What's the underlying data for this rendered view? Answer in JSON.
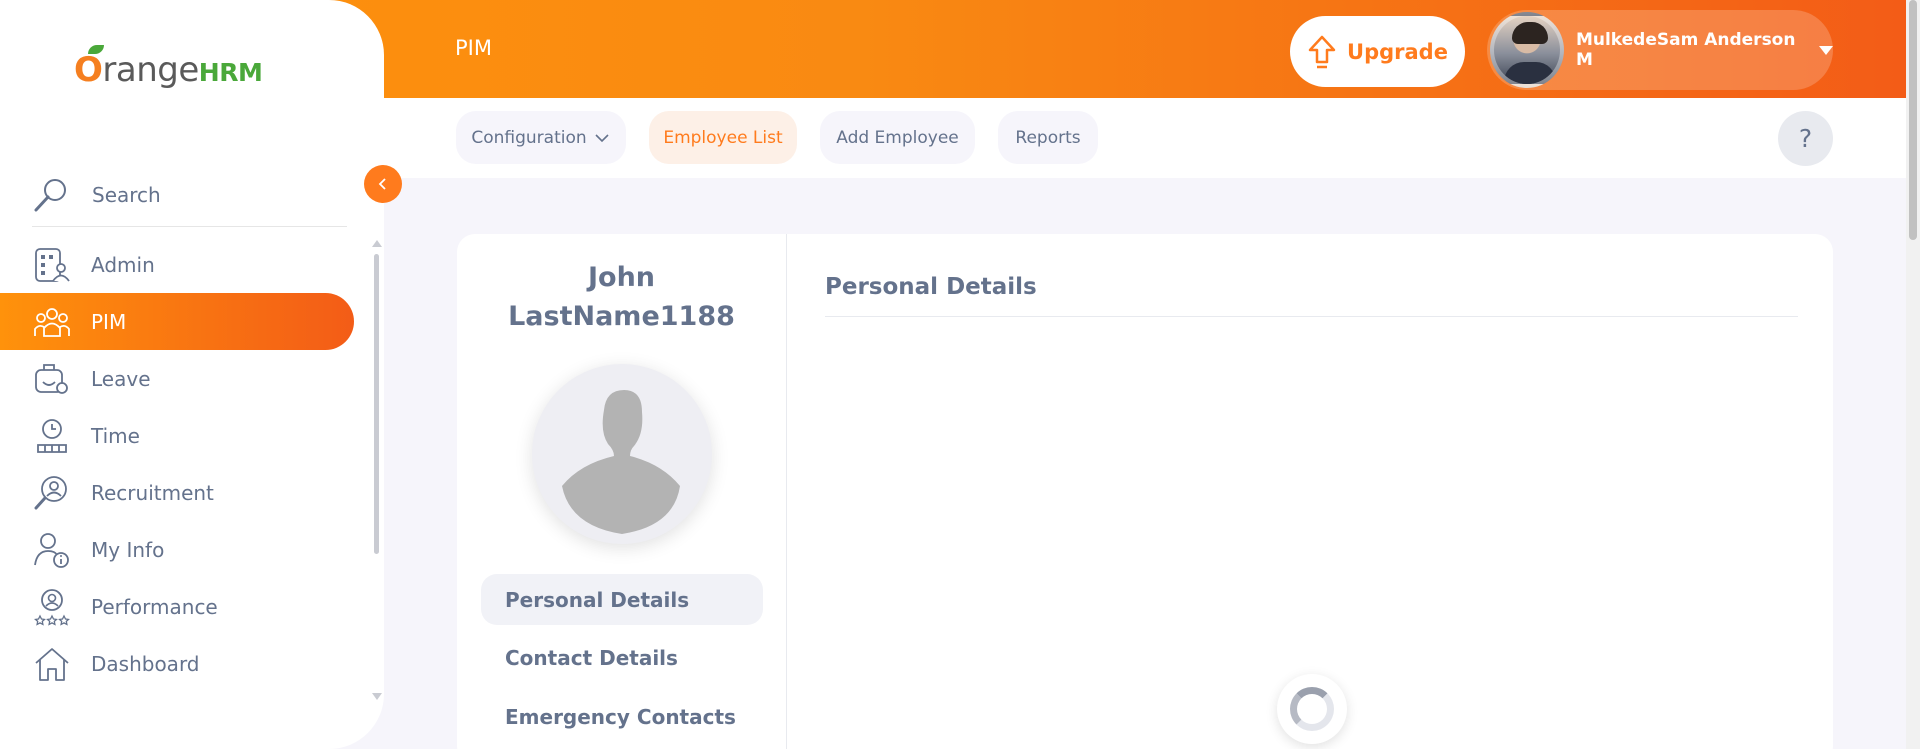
{
  "header": {
    "module_title": "PIM",
    "upgrade_label": "Upgrade",
    "user_name": "MulkedeSam Anderson M"
  },
  "subnav": {
    "items": [
      {
        "label": "Configuration",
        "has_dropdown": true,
        "active": false
      },
      {
        "label": "Employee List",
        "active": true
      },
      {
        "label": "Add Employee",
        "active": false
      },
      {
        "label": "Reports",
        "active": false
      }
    ],
    "help_label": "?"
  },
  "sidebar": {
    "logo_o": "O",
    "logo_range": "range",
    "logo_hrm": "HRM",
    "search_label": "Search",
    "items": [
      {
        "label": "Admin",
        "icon": "admin-icon"
      },
      {
        "label": "PIM",
        "icon": "pim-icon",
        "active": true
      },
      {
        "label": "Leave",
        "icon": "leave-icon"
      },
      {
        "label": "Time",
        "icon": "time-icon"
      },
      {
        "label": "Recruitment",
        "icon": "recruitment-icon"
      },
      {
        "label": "My Info",
        "icon": "my-info-icon"
      },
      {
        "label": "Performance",
        "icon": "performance-icon"
      },
      {
        "label": "Dashboard",
        "icon": "dashboard-icon"
      }
    ]
  },
  "employee": {
    "first_name": "John",
    "last_name": "LastName1188"
  },
  "profile_tabs": [
    {
      "label": "Personal Details",
      "active": true
    },
    {
      "label": "Contact Details"
    },
    {
      "label": "Emergency Contacts"
    }
  ],
  "content": {
    "section_title": "Personal Details"
  },
  "colors": {
    "accent": "#ff7b1d",
    "header_gradient_start": "#ff920b",
    "header_gradient_end": "#f35c17",
    "text": "#64728c"
  }
}
